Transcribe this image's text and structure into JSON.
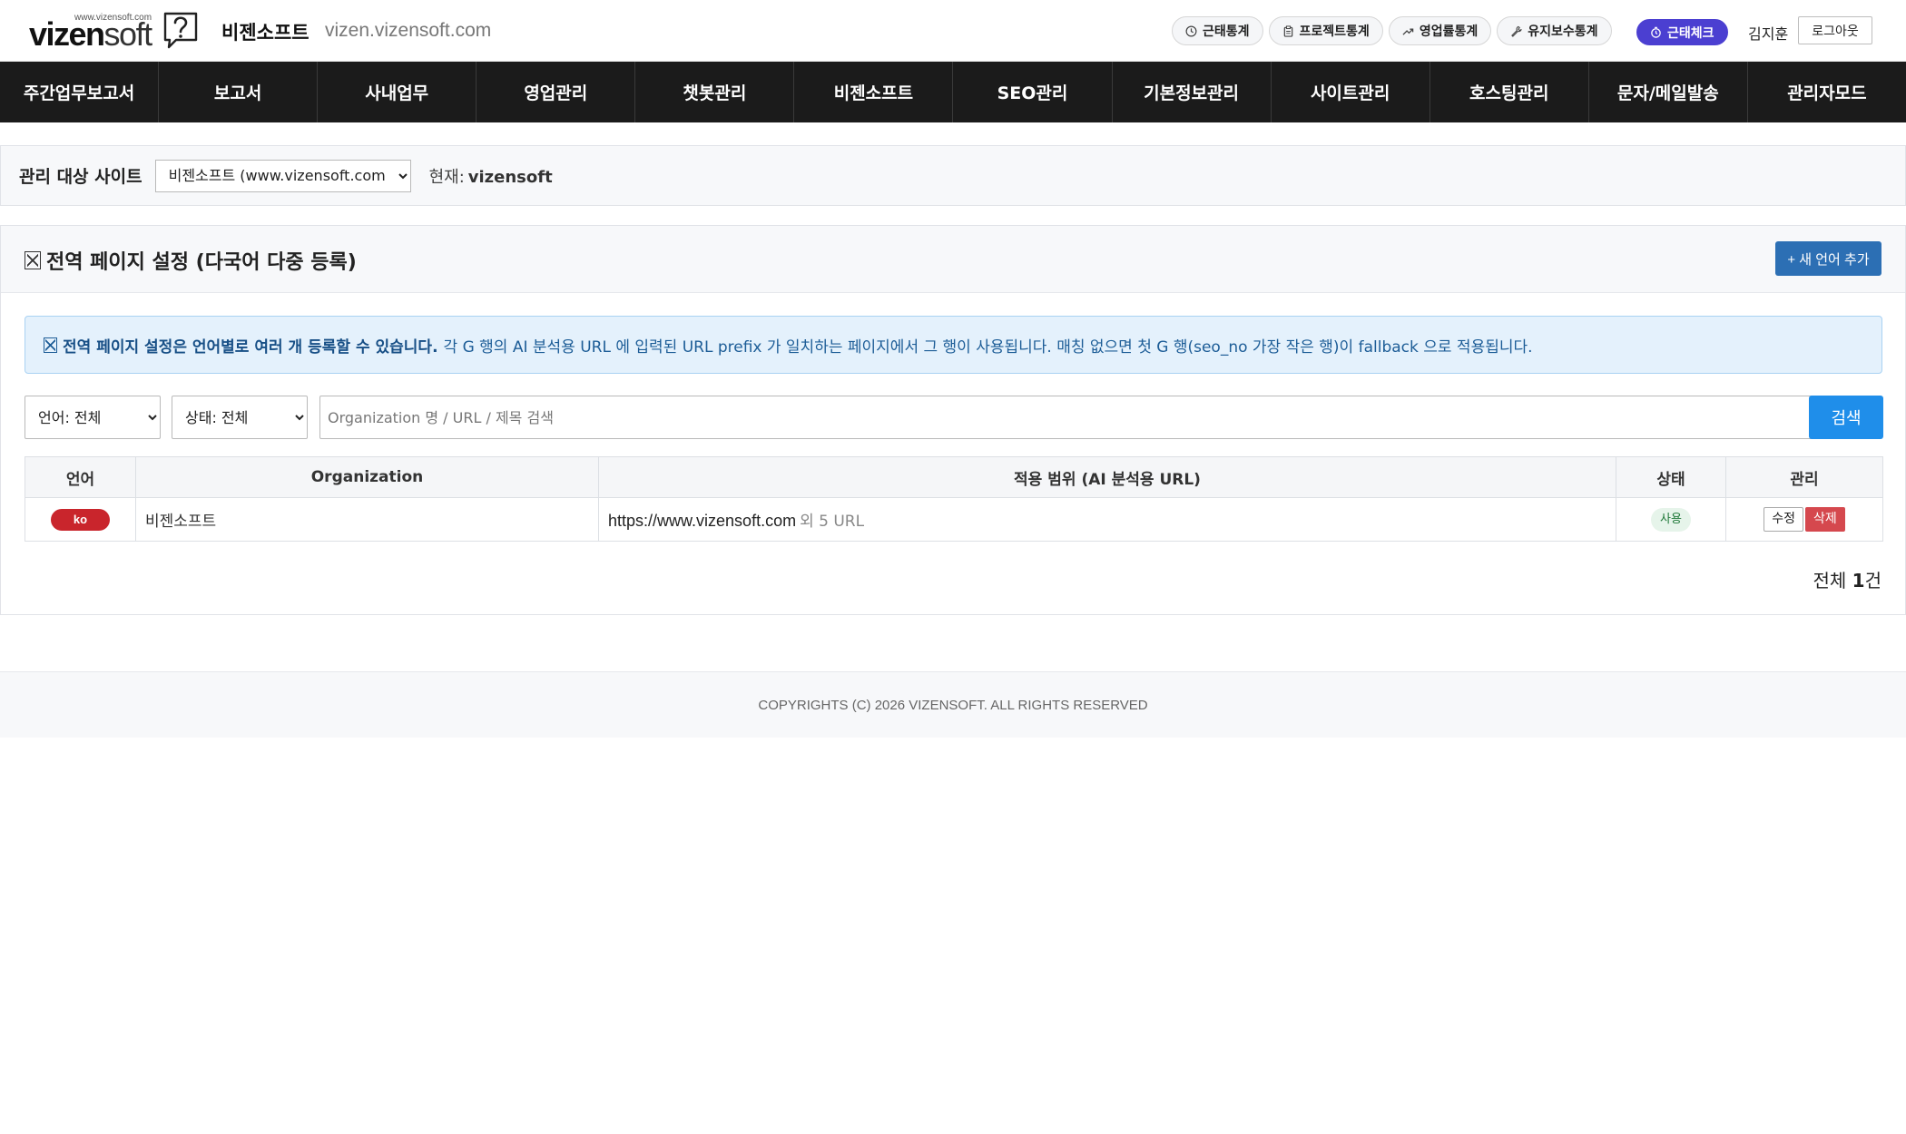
{
  "header": {
    "logo": {
      "domain_small": "www.vizensoft.com",
      "word_bold": "vizen",
      "word_light": "soft"
    },
    "brand": "비젠소프트",
    "host": "vizen.vizensoft.com",
    "quick_links": [
      {
        "label": "근태통계",
        "icon": "clock-icon"
      },
      {
        "label": "프로젝트통계",
        "icon": "clipboard-icon"
      },
      {
        "label": "영업률통계",
        "icon": "trend-up-icon"
      },
      {
        "label": "유지보수통계",
        "icon": "wrench-icon"
      }
    ],
    "attendance_check": {
      "label": "근태체크",
      "icon": "timer-icon"
    },
    "user_name": "김지훈",
    "logout_label": "로그아웃"
  },
  "nav": {
    "items": [
      "주간업무보고서",
      "보고서",
      "사내업무",
      "영업관리",
      "챗봇관리",
      "비젠소프트",
      "SEO관리",
      "기본정보관리",
      "사이트관리",
      "호스팅관리",
      "문자/메일발송",
      "관리자모드"
    ]
  },
  "site_selector": {
    "label": "관리 대상 사이트",
    "selected": "비젠소프트 (www.vizensoft.com)",
    "current_label": "현재:",
    "current_value": "vizensoft"
  },
  "panel": {
    "title": "전역 페이지 설정 (다국어 다중 등록)",
    "add_button": "+ 새 언어 추가",
    "notice": {
      "bold": "전역 페이지 설정은 언어별로 여러 개 등록할 수 있습니다.",
      "text": "각 G 행의 AI 분석용 URL 에 입력된 URL prefix 가 일치하는 페이지에서 그 행이 사용됩니다. 매칭 없으면 첫 G 행(seo_no 가장 작은 행)이 fallback 으로 적용됩니다."
    },
    "filters": {
      "language": "언어: 전체",
      "status": "상태: 전체",
      "search_placeholder": "Organization 명 / URL / 제목 검색",
      "search_button": "검색"
    },
    "table": {
      "headers": {
        "lang": "언어",
        "org": "Organization",
        "scope": "적용 범위 (AI 분석용 URL)",
        "state": "상태",
        "admin": "관리"
      },
      "rows": [
        {
          "lang": "ko",
          "org": "비젠소프트",
          "url": "https://www.vizensoft.com",
          "url_more": "외 5 URL",
          "state": "사용",
          "edit": "수정",
          "delete": "삭제"
        }
      ]
    },
    "total": {
      "prefix": "전체",
      "count": "1",
      "suffix": "건"
    }
  },
  "footer": {
    "text": "COPYRIGHTS (C) 2026 VIZENSOFT. ALL RIGHTS RESERVED"
  },
  "colors": {
    "nav_bg": "#1b1b1b",
    "primary_button": "#2c6fb4",
    "search_button": "#1f8eea",
    "attendance_check": "#4b3fd1",
    "lang_badge": "#c9252c",
    "delete_button": "#d5484e"
  }
}
